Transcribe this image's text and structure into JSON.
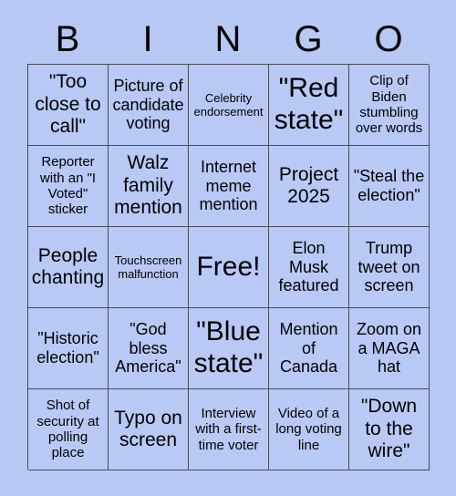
{
  "card": {
    "header_letters": [
      "B",
      "I",
      "N",
      "G",
      "O"
    ],
    "rows": [
      [
        {
          "text": "\"Too close to call\"",
          "size": "lg"
        },
        {
          "text": "Picture of candidate voting",
          "size": "md"
        },
        {
          "text": "Celebrity endorsement",
          "size": "xs"
        },
        {
          "text": "\"Red state\"",
          "size": "xl"
        },
        {
          "text": "Clip of Biden stumbling over words",
          "size": "sm"
        }
      ],
      [
        {
          "text": "Reporter with an \"I Voted\" sticker",
          "size": "sm"
        },
        {
          "text": "Walz family mention",
          "size": "lg"
        },
        {
          "text": "Internet meme mention",
          "size": "md"
        },
        {
          "text": "Project 2025",
          "size": "lg"
        },
        {
          "text": "\"Steal the election\"",
          "size": "md"
        }
      ],
      [
        {
          "text": "People chanting",
          "size": "lg"
        },
        {
          "text": "Touchscreen malfunction",
          "size": "xs"
        },
        {
          "text": "Free!",
          "size": "xl"
        },
        {
          "text": "Elon Musk featured",
          "size": "md"
        },
        {
          "text": "Trump tweet on screen",
          "size": "md"
        }
      ],
      [
        {
          "text": "\"Historic election\"",
          "size": "md"
        },
        {
          "text": "\"God bless America\"",
          "size": "md"
        },
        {
          "text": "\"Blue state\"",
          "size": "xl"
        },
        {
          "text": "Mention of Canada",
          "size": "md"
        },
        {
          "text": "Zoom on a MAGA hat",
          "size": "md"
        }
      ],
      [
        {
          "text": "Shot of security at polling place",
          "size": "sm"
        },
        {
          "text": "Typo on screen",
          "size": "lg"
        },
        {
          "text": "Interview with a first-time voter",
          "size": "sm"
        },
        {
          "text": "Video of a long voting line",
          "size": "sm"
        },
        {
          "text": "\"Down to the wire\"",
          "size": "lg"
        }
      ]
    ],
    "colors": {
      "background": "#b8c8f5",
      "cell_fill": "#b9c9f5",
      "border": "#4a4a5a",
      "text": "#000000"
    }
  }
}
